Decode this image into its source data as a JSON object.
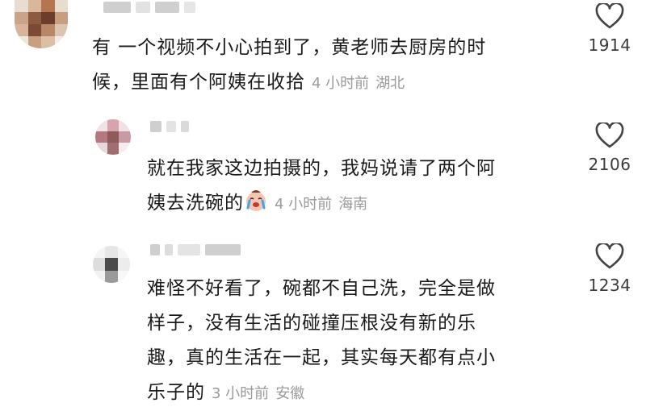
{
  "comments": [
    {
      "username_masked": true,
      "text_lines": [
        "有  一个视频不小心拍到了，黄老师去厨房的时",
        "候，里面有个阿姨在收拾"
      ],
      "time": "4 小时前",
      "location": "湖北",
      "likes": "1914"
    },
    {
      "username_masked": true,
      "text_lines": [
        "就在我家这边拍摄的，我妈说请了两个阿",
        "姨去洗碗的"
      ],
      "emoji": "crying-face-emoji",
      "time": "4 小时前",
      "location": "海南",
      "likes": "2106"
    },
    {
      "username_masked": true,
      "text_lines": [
        "难怪不好看了，碗都不自己洗，完全是做",
        "样子，没有生活的碰撞压根没有新的乐",
        "趣，真的生活在一起，其实每天都有点小",
        "乐子的"
      ],
      "time": "3 小时前",
      "location": "安徽",
      "likes": "1234"
    }
  ],
  "icons": {
    "like": "heart-outline-icon"
  },
  "colors": {
    "text": "#1a1a1a",
    "meta": "#9a9a9a",
    "count": "#3b3b3b",
    "icon": "#444444"
  }
}
